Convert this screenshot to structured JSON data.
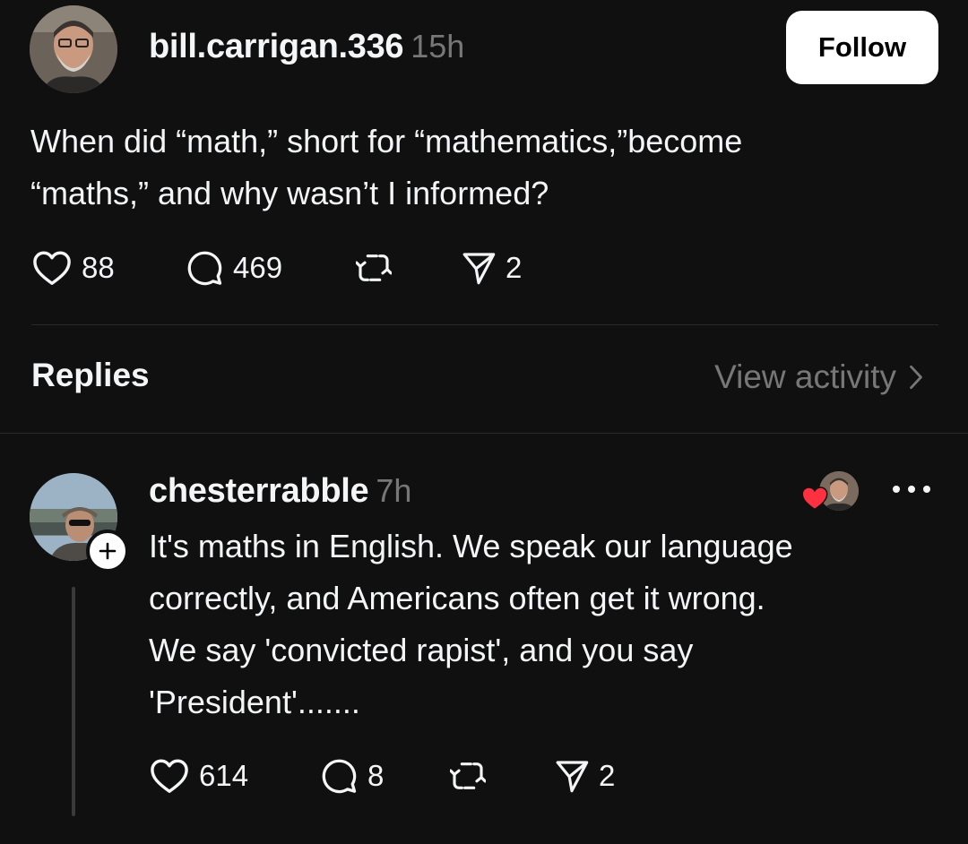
{
  "post": {
    "username": "bill.carrigan.336",
    "time": "15h",
    "follow_label": "Follow",
    "text": "When did “math,” short for “mathematics,”become\n“maths,” and why wasn’t I informed?",
    "likes": "88",
    "replies": "469",
    "shares": "2",
    "icons": [
      "heart-icon",
      "comment-icon",
      "repost-icon",
      "send-icon"
    ]
  },
  "replies_section": {
    "heading": "Replies",
    "view_activity": "View activity"
  },
  "reply": {
    "username": "chesterrabble",
    "time": "7h",
    "text": "It's maths in English. We speak our language\ncorrectly, and Americans often get it wrong.\nWe say 'convicted rapist', and you say\n'President'.......",
    "likes": "614",
    "replies": "8",
    "shares": "2",
    "liked_by_author": true
  },
  "colors": {
    "background": "#101010",
    "text": "#f3f5f7",
    "muted": "#777777",
    "heart": "#ff3040",
    "follow_bg": "#ffffff"
  }
}
